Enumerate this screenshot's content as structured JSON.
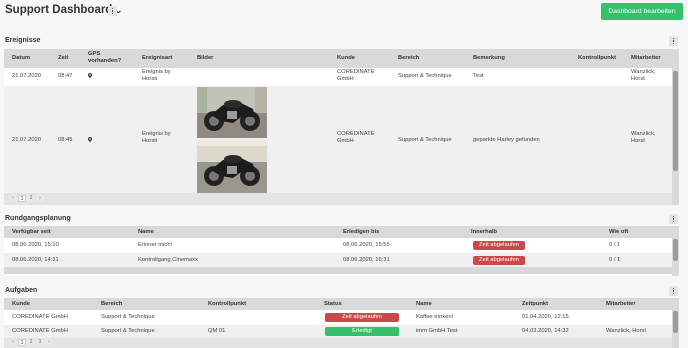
{
  "header": {
    "title": "Support Dashboard",
    "edit_label": "Dashboard bearbeiten"
  },
  "events": {
    "title": "Ereignisse",
    "columns": [
      "Datum",
      "Zeit",
      "GPS vorhanden?",
      "Ereignisart",
      "Bilder",
      "Kunde",
      "Bereich",
      "Bemerkung",
      "Kontrollpunkt",
      "Mitarbeiter"
    ],
    "rows": [
      {
        "date": "21.07.2020",
        "time": "08:47",
        "type": "Ereignis by Horsti",
        "customer": "COREDINATE GmbH",
        "area": "Support & Technique",
        "remark": "Test",
        "checkpoint": "",
        "employee": "Wanzlick, Horst"
      },
      {
        "date": "21.07.2020",
        "time": "08:45",
        "type": "Ereignis by Horsti",
        "customer": "COREDINATE GmbH",
        "area": "Support & Technique",
        "remark": "geparkte Harley gefunden",
        "checkpoint": "",
        "employee": "Wanzlick, Horst"
      }
    ],
    "pager": [
      "‹",
      "1",
      "2",
      "›"
    ]
  },
  "tours": {
    "title": "Rundgangsplanung",
    "columns": [
      "Verfügbar seit",
      "Name",
      "Erledigen bis",
      "Innerhalb",
      "Wie oft"
    ],
    "rows": [
      {
        "since": "08.06.2020, 15:10",
        "name": "Erinner mich!",
        "until": "08.06.2020, 15:55",
        "within": "Zeit abgelaufen",
        "count": "0 / 1"
      },
      {
        "since": "08.06.2020, 14:31",
        "name": "Kontrollgang Cinemaxx",
        "until": "08.06.2020, 16:31",
        "within": "Zeit abgelaufen",
        "count": "0 / 1"
      }
    ]
  },
  "tasks": {
    "title": "Aufgaben",
    "columns": [
      "Kunde",
      "Bereich",
      "Kontrollpunkt",
      "Status",
      "Name",
      "Zeitpunkt",
      "Mitarbeiter"
    ],
    "rows": [
      {
        "customer": "COREDINATE GmbH",
        "area": "Support & Technique",
        "checkpoint": "",
        "status": "Zeit abgelaufen",
        "name": "Kaffee trinken!",
        "time": "01.04.2020, 12:15",
        "employee": ""
      },
      {
        "customer": "COREDINATE GmbH",
        "area": "Support & Technique",
        "checkpoint": "QM 01",
        "status": "Erledigt",
        "name": "imm GmbH Test",
        "time": "04.03.2020, 14:32",
        "employee": "Wanzlick, Horst"
      }
    ],
    "pager": [
      "‹",
      "1",
      "2",
      "3",
      "›"
    ]
  },
  "colors": {
    "accent_green": "#35c16b",
    "status_red": "#c94a4a",
    "header_gray": "#d8d9da"
  },
  "icons": {
    "gps": "map-pin-icon",
    "menu": "kebab-menu-icon",
    "dropdown": "chevron-down-icon"
  }
}
